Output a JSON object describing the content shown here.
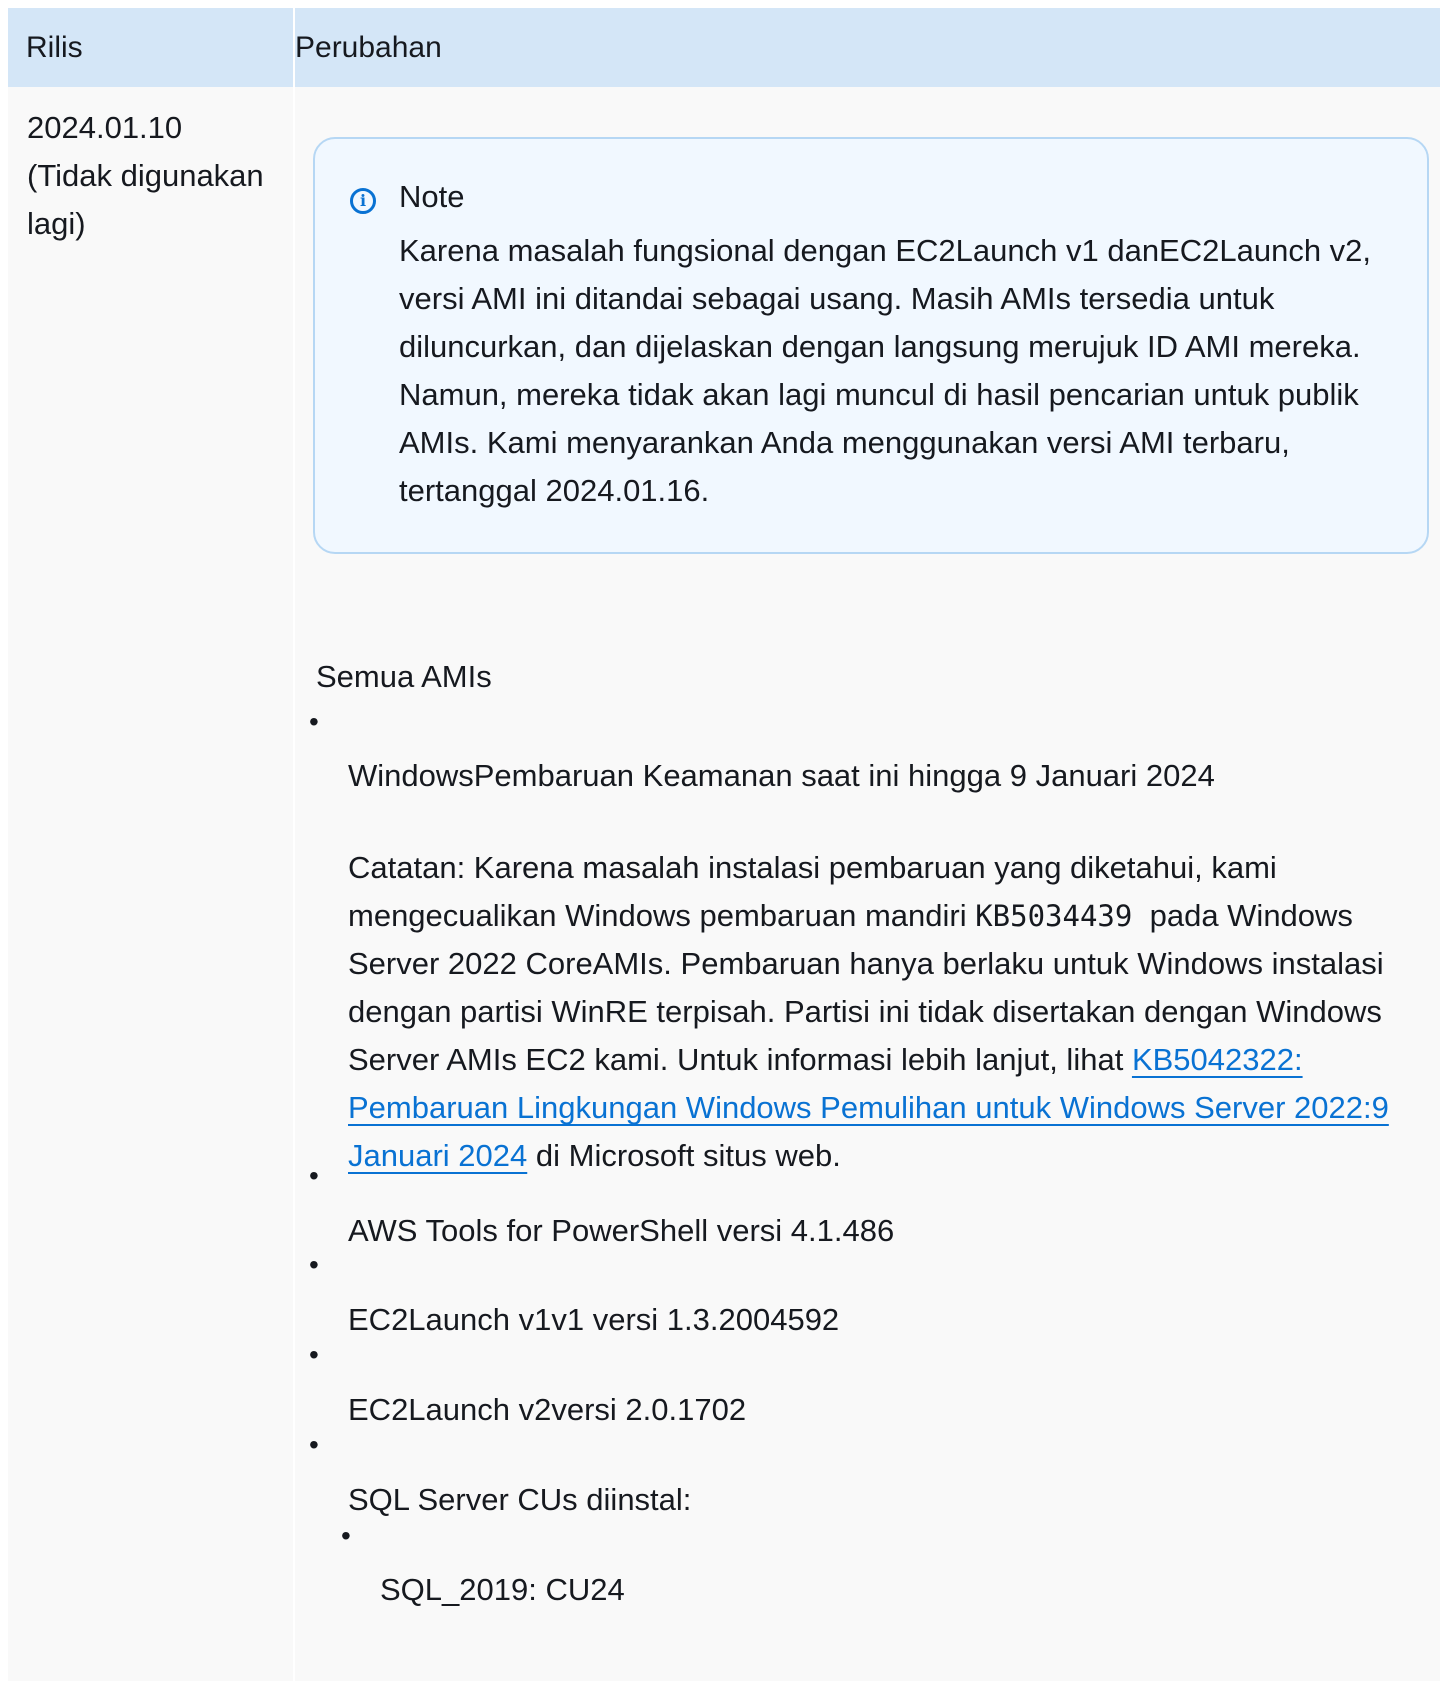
{
  "table": {
    "headers": [
      "Rilis",
      "Perubahan"
    ]
  },
  "release": {
    "version": "2024.01.10",
    "status": "(Tidak digunakan lagi)"
  },
  "note": {
    "icon": "info-icon",
    "title": "Note",
    "body": "Karena masalah fungsional dengan EC2Launch v1 danEC2Launch v2, versi AMI ini ditandai sebagai usang. Masih AMIs tersedia untuk diluncurkan, dan dijelaskan dengan langsung merujuk ID AMI mereka. Namun, mereka tidak akan lagi muncul di hasil pencarian untuk publik AMIs. Kami menyarankan Anda menggunakan versi AMI terbaru, tertanggal 2024.01.16."
  },
  "changes": {
    "section_title": "Semua AMIs",
    "security_update": "WindowsPembaruan Keamanan saat ini hingga 9 Januari 2024",
    "catatan": {
      "text_1": "Catatan: Karena masalah instalasi pembaruan yang diketahui, kami mengecualikan Windows pembaruan mandiri",
      "kb_code": "KB5034439",
      "text_2": "pada Windows Server 2022 CoreAMIs. Pembaruan hanya berlaku untuk Windows instalasi dengan partisi WinRE terpisah. Partisi ini tidak disertakan dengan Windows Server AMIs EC2 kami. Untuk informasi lebih lanjut, lihat",
      "link_text": "KB5042322: Pembaruan Lingkungan Windows Pemulihan untuk Windows Server 2022:9 Januari 2024",
      "text_3": "di Microsoft situs web."
    },
    "items": [
      "AWS Tools for PowerShell versi 4.1.486",
      "EC2Launch v1v1 versi 1.3.2004592",
      "EC2Launch v2versi 2.0.1702",
      "SQL Server CUs diinstal:"
    ],
    "sub_items": [
      "SQL_2019: CU24"
    ]
  },
  "colors": {
    "header_bg": "#d4e6f7",
    "note_bg": "#f1f8ff",
    "note_border": "#b6d7f4",
    "link": "#0972d3"
  }
}
